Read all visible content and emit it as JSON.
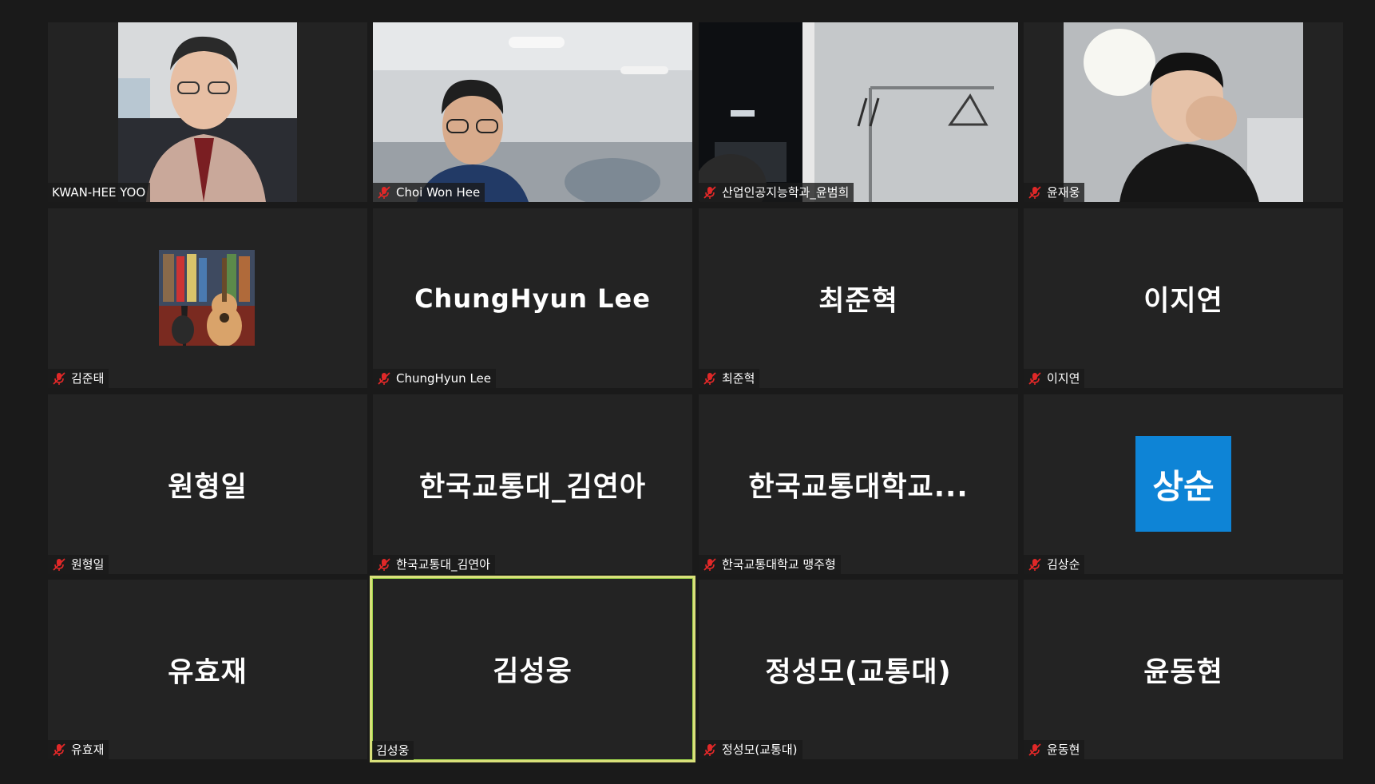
{
  "participants": [
    {
      "name": "KWAN-HEE YOO",
      "muted": false,
      "video": true
    },
    {
      "name": "Choi Won Hee",
      "muted": true,
      "video": true
    },
    {
      "name": "산업인공지능학과_윤범희",
      "muted": true,
      "video": true
    },
    {
      "name": "윤재웅",
      "muted": true,
      "video": true
    },
    {
      "name": "김준태",
      "muted": true,
      "video": false,
      "avatar": "guitar-photo"
    },
    {
      "name": "ChungHyun Lee",
      "display": "ChungHyun Lee",
      "muted": true,
      "video": false
    },
    {
      "name": "최준혁",
      "display": "최준혁",
      "muted": true,
      "video": false
    },
    {
      "name": "이지연",
      "display": "이지연",
      "muted": true,
      "video": false
    },
    {
      "name": "원형일",
      "display": "원형일",
      "muted": true,
      "video": false
    },
    {
      "name": "한국교통대_김연아",
      "display": "한국교통대_김연아",
      "muted": true,
      "video": false
    },
    {
      "name": "한국교통대학교 맹주형",
      "display": "한국교통대학교...",
      "muted": true,
      "video": false
    },
    {
      "name": "김상순",
      "initials": "상순",
      "muted": true,
      "video": false
    },
    {
      "name": "유효재",
      "display": "유효재",
      "muted": true,
      "video": false
    },
    {
      "name": "김성웅",
      "display": "김성웅",
      "muted": false,
      "video": false,
      "active_speaker": true
    },
    {
      "name": "정성모(교통대)",
      "display": "정성모(교통대)",
      "muted": true,
      "video": false
    },
    {
      "name": "윤동현",
      "display": "윤동현",
      "muted": true,
      "video": false
    }
  ],
  "colors": {
    "background": "#1a1a1a",
    "tile": "#232323",
    "mute_red": "#e02828",
    "speaker_border": "#d9e07a",
    "avatar_blue": "#0e84d6"
  }
}
